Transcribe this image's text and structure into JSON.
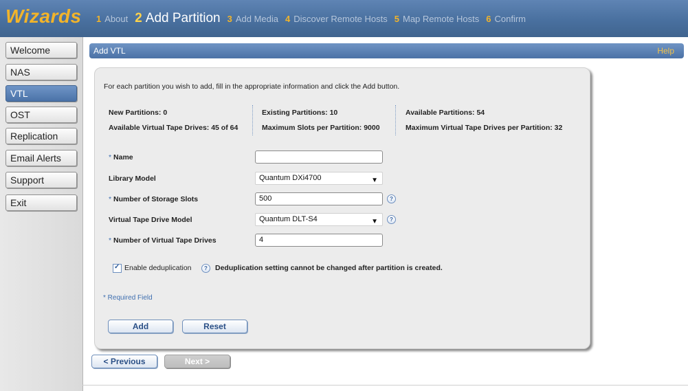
{
  "app": {
    "logo": "Wizards"
  },
  "steps": [
    {
      "num": "1",
      "label": "About"
    },
    {
      "num": "2",
      "label": "Add Partition"
    },
    {
      "num": "3",
      "label": "Add Media"
    },
    {
      "num": "4",
      "label": "Discover Remote Hosts"
    },
    {
      "num": "5",
      "label": "Map Remote Hosts"
    },
    {
      "num": "6",
      "label": "Confirm"
    }
  ],
  "sidebar": {
    "items": [
      {
        "label": "Welcome"
      },
      {
        "label": "NAS"
      },
      {
        "label": "VTL"
      },
      {
        "label": "OST"
      },
      {
        "label": "Replication"
      },
      {
        "label": "Email Alerts"
      },
      {
        "label": "Support"
      },
      {
        "label": "Exit"
      }
    ],
    "active": "VTL"
  },
  "header": {
    "title": "Add VTL",
    "help": "Help"
  },
  "panel": {
    "intro": "For each partition you wish to add, fill in the appropriate information and click the Add button.",
    "stats": {
      "new_partitions": "New Partitions: 0",
      "available_drives": "Available Virtual Tape Drives: 45 of 64",
      "existing_partitions": "Existing Partitions: 10",
      "max_slots": "Maximum Slots per Partition: 9000",
      "available_partitions": "Available Partitions: 54",
      "max_drives": "Maximum Virtual Tape Drives per Partition: 32"
    },
    "form": {
      "required_marker": "*",
      "name_label": "Name",
      "name_value": "",
      "library_label": "Library Model",
      "library_value": "Quantum DXi4700",
      "slots_label": "Number of Storage Slots",
      "slots_value": "500",
      "drive_model_label": "Virtual Tape Drive Model",
      "drive_model_value": "Quantum DLT-S4",
      "drives_label": "Number of Virtual Tape Drives",
      "drives_value": "4",
      "help_glyph": "?",
      "dedup_label": "Enable deduplication",
      "dedup_checked": true,
      "dedup_note": "Deduplication setting cannot be changed after partition is created.",
      "required_note": "* Required Field"
    },
    "buttons": {
      "add": "Add",
      "reset": "Reset"
    }
  },
  "footer_nav": {
    "previous": "< Previous",
    "next": "Next >"
  },
  "colors": {
    "topbar": "#49709f",
    "accent_gold": "#f2b42a",
    "sidebar_active": "#5a82b8",
    "panel_bg": "#ececec"
  }
}
